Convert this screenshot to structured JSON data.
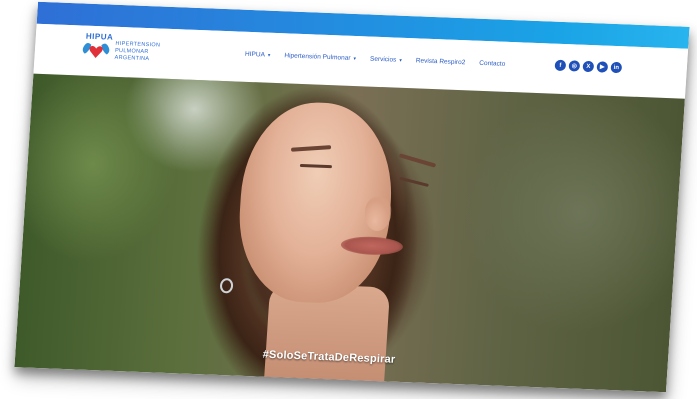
{
  "brand": {
    "abbr": "HIPUA",
    "name_lines": [
      "HIPERTENSION",
      "PULMONAR",
      "ARGENTINA"
    ]
  },
  "nav": {
    "items": [
      {
        "label": "HIPUA",
        "has_caret": true
      },
      {
        "label": "Hipertensión Pulmonar",
        "has_caret": true
      },
      {
        "label": "Servicios",
        "has_caret": true
      },
      {
        "label": "Revista Respiro2",
        "has_caret": false
      },
      {
        "label": "Contacto",
        "has_caret": false
      }
    ],
    "caret": "▾",
    "social": [
      {
        "icon": "facebook-icon",
        "glyph": "f"
      },
      {
        "icon": "instagram-icon",
        "glyph": "◎"
      },
      {
        "icon": "x-icon",
        "glyph": "X"
      },
      {
        "icon": "youtube-icon",
        "glyph": "▶"
      },
      {
        "icon": "linkedin-icon",
        "glyph": "in"
      }
    ]
  },
  "hero": {
    "hashtag": "#SoloSeTrataDeRespirar"
  },
  "colors": {
    "accent": "#2f6fd6",
    "nav_text": "#2a5bc4",
    "social_bg": "#1f4fb8",
    "logo_heart": "#e0313a"
  }
}
